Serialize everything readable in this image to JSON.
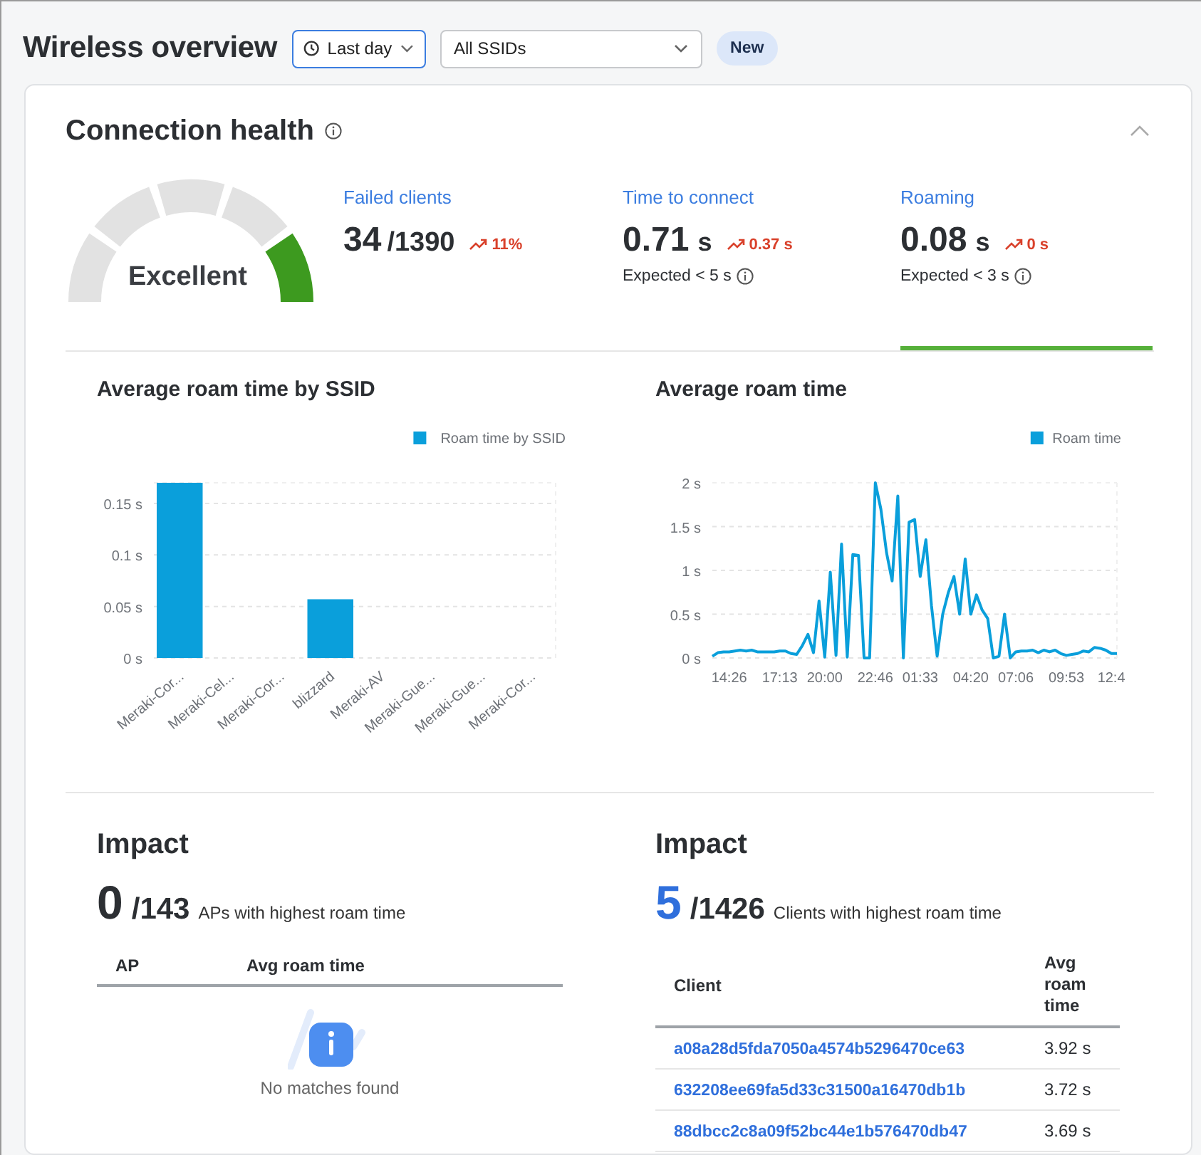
{
  "header": {
    "title": "Wireless overview",
    "time_filter": {
      "label": "Last day"
    },
    "ssid_filter": {
      "label": "All SSIDs"
    },
    "badge": "New"
  },
  "connection_health": {
    "title": "Connection health",
    "expanded": true,
    "gauge": {
      "label": "Excellent",
      "level": 1
    },
    "metrics": [
      {
        "label": "Failed clients",
        "value": "34",
        "total": "/1390",
        "trend": "11%",
        "selected": false
      },
      {
        "label": "Time to connect",
        "value": "0.71",
        "unit": "s",
        "trend": "0.37 s",
        "expected": "Expected < 5 s",
        "selected": false
      },
      {
        "label": "Roaming",
        "value": "0.08",
        "unit": "s",
        "trend": "0 s",
        "expected": "Expected < 3 s",
        "selected": true
      }
    ],
    "charts": [
      {
        "title": "Average roam time by SSID",
        "chart_data": {
          "type": "bar",
          "categories": [
            "Meraki-Cor...",
            "Meraki-Cel...",
            "Meraki-Cor...",
            "blizzard",
            "Meraki-AV",
            "Meraki-Gue...",
            "Meraki-Gue...",
            "Meraki-Cor..."
          ],
          "series": [
            {
              "name": "Roam time by SSID",
              "color": "#0a9fdb",
              "values": [
                0.17,
                0,
                0,
                0.057,
                0,
                0,
                0,
                0
              ]
            }
          ],
          "ylim": [
            0,
            0.17
          ],
          "grid": true,
          "yticks": [
            {
              "value": 0,
              "label": "0 s"
            },
            {
              "value": 0.05,
              "label": "0.05 s"
            },
            {
              "value": 0.1,
              "label": "0.1 s"
            },
            {
              "value": 0.15,
              "label": "0.15 s"
            }
          ]
        }
      },
      {
        "title": "Average roam time",
        "chart_data": {
          "type": "line",
          "categories": [
            null,
            null,
            null,
            "14:26",
            null,
            null,
            null,
            null,
            null,
            null,
            null,
            null,
            "17:13",
            null,
            null,
            null,
            null,
            null,
            null,
            null,
            "20:00",
            null,
            null,
            null,
            null,
            null,
            null,
            null,
            null,
            "22:46",
            null,
            null,
            null,
            null,
            null,
            null,
            null,
            "01:33",
            null,
            null,
            null,
            null,
            null,
            null,
            null,
            null,
            "04:20",
            null,
            null,
            null,
            null,
            null,
            null,
            null,
            "07:06",
            null,
            null,
            null,
            null,
            null,
            null,
            null,
            null,
            "09:53",
            null,
            null,
            null,
            null,
            null,
            null,
            null,
            "12:4",
            null
          ],
          "series": [
            {
              "name": "Roam time",
              "color": "#0a9fdb",
              "values": [
                0.02,
                0.06,
                0.07,
                0.07,
                0.08,
                0.09,
                0.08,
                0.09,
                0.07,
                0.07,
                0.07,
                0.07,
                0.08,
                0.08,
                0.05,
                0.04,
                0.14,
                0.27,
                0.06,
                0.65,
                0.01,
                0.98,
                0.03,
                1.3,
                0.01,
                1.18,
                1.17,
                0,
                0,
                2,
                1.7,
                1.2,
                0.88,
                1.85,
                0,
                1.55,
                1.58,
                0.93,
                1.35,
                0.6,
                0.02,
                0.5,
                0.75,
                0.93,
                0.5,
                1.13,
                0.5,
                0.72,
                0.55,
                0.45,
                0,
                0.02,
                0.5,
                0,
                0.07,
                0.08,
                0.08,
                0.09,
                0.06,
                0.09,
                0.07,
                0.09,
                0.05,
                0.03,
                0.04,
                0.05,
                0.08,
                0.07,
                0.12,
                0.11,
                0.09,
                0.05,
                0.05
              ]
            }
          ],
          "ylim": [
            0,
            2
          ],
          "grid": true,
          "yticks": [
            {
              "value": 0,
              "label": "0 s"
            },
            {
              "value": 0.5,
              "label": "0.5 s"
            },
            {
              "value": 1,
              "label": "1 s"
            },
            {
              "value": 1.5,
              "label": "1.5 s"
            },
            {
              "value": 2,
              "label": "2 s"
            }
          ]
        }
      }
    ],
    "impact": [
      {
        "title": "Impact",
        "count": "0",
        "highlighted": false,
        "total": "/143",
        "caption": "APs with highest roam time",
        "columns": [
          "AP",
          "Avg roam time"
        ],
        "empty_message": "No matches found"
      },
      {
        "title": "Impact",
        "count": "5",
        "highlighted": true,
        "total": "/1426",
        "caption": "Clients with highest roam time",
        "columns": [
          "Client",
          "Avg roam time"
        ],
        "rows": [
          {
            "client": "a08a28d5fda7050a4574b5296470ce63",
            "avg_roam_time": "3.92 s"
          },
          {
            "client": "632208ee69fa5d33c31500a16470db1b",
            "avg_roam_time": "3.72 s"
          },
          {
            "client": "88dbcc2c8a09f52bc44e1b576470db47",
            "avg_roam_time": "3.69 s"
          }
        ]
      }
    ]
  }
}
